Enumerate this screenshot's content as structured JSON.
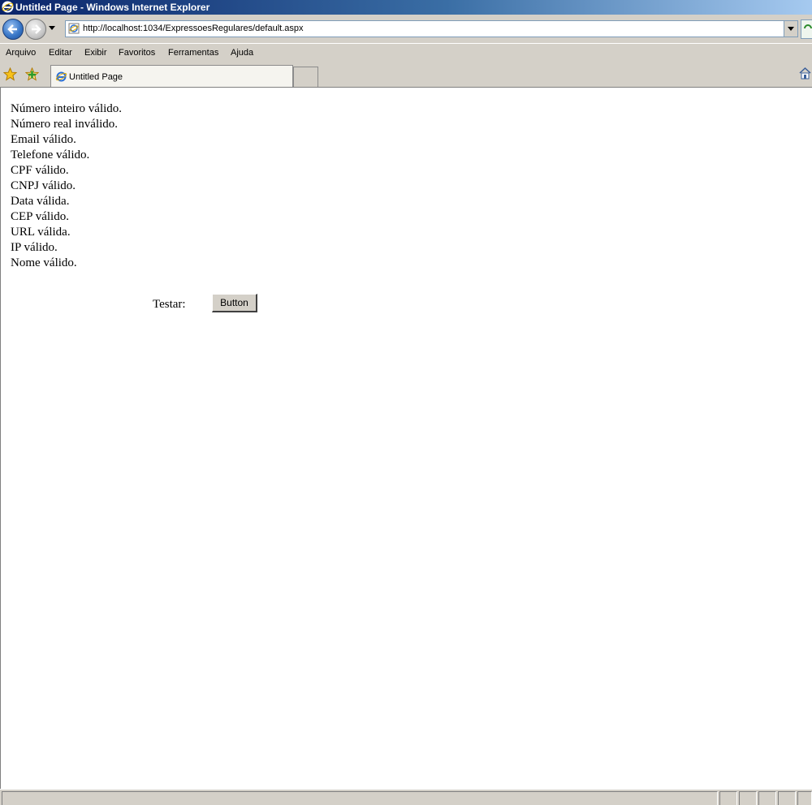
{
  "window": {
    "title": "Untitled Page - Windows Internet Explorer"
  },
  "address_bar": {
    "url": "http://localhost:1034/ExpressoesRegulares/default.aspx"
  },
  "menu": {
    "items": [
      "Arquivo",
      "Editar",
      "Exibir",
      "Favoritos",
      "Ferramentas",
      "Ajuda"
    ]
  },
  "tab": {
    "label": "Untitled Page"
  },
  "page": {
    "results": [
      "Número inteiro válido.",
      "Número real inválido.",
      "Email válido.",
      "Telefone válido.",
      "CPF válido.",
      "CNPJ válido.",
      "Data válida.",
      "CEP válido.",
      "URL válida.",
      "IP válido.",
      "Nome válido."
    ],
    "test_label": "Testar:",
    "button_label": "Button"
  },
  "colors": {
    "titlebar_start": "#0a246a",
    "chrome": "#d4d0c8",
    "content_bg": "#ffffff"
  },
  "icons": [
    "ie-icon",
    "back-arrow-icon",
    "forward-arrow-icon",
    "page-icon",
    "favorites-star-icon",
    "add-favorite-icon",
    "home-icon"
  ]
}
